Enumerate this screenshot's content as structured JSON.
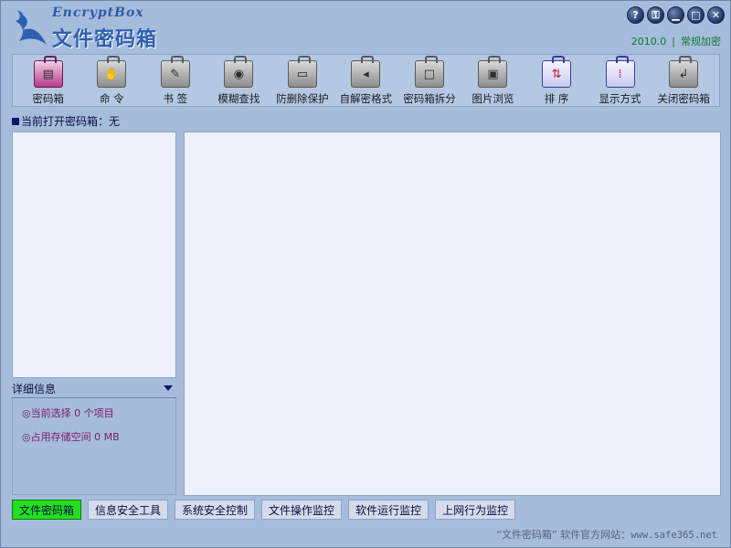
{
  "app": {
    "logo_script": "EncryptBox",
    "title": "文件密码箱",
    "version": "2010.0",
    "separator": "|",
    "edition": "常规加密"
  },
  "window_controls": [
    {
      "name": "help",
      "glyph": "?"
    },
    {
      "name": "key",
      "glyph": "⚿"
    },
    {
      "name": "minimize-to-tray",
      "glyph": "▁"
    },
    {
      "name": "maximize",
      "glyph": "□"
    },
    {
      "name": "close",
      "glyph": "✕"
    }
  ],
  "toolbar": {
    "items": [
      {
        "label": "密码箱",
        "icon": "password-box-icon",
        "glyph": "▤"
      },
      {
        "label": "命  令",
        "icon": "command-icon",
        "glyph": "✋"
      },
      {
        "label": "书  签",
        "icon": "bookmark-icon",
        "glyph": "✎"
      },
      {
        "label": "模糊查找",
        "icon": "search-icon",
        "glyph": "◉"
      },
      {
        "label": "防删除保护",
        "icon": "delete-protect-icon",
        "glyph": "▭"
      },
      {
        "label": "自解密格式",
        "icon": "self-decrypt-icon",
        "glyph": "◂"
      },
      {
        "label": "密码箱拆分",
        "icon": "split-icon",
        "glyph": "□"
      },
      {
        "label": "图片浏览",
        "icon": "image-browse-icon",
        "glyph": "▣"
      },
      {
        "label": "排  序",
        "icon": "sort-icon",
        "glyph": "⇅"
      },
      {
        "label": "显示方式",
        "icon": "view-mode-icon",
        "glyph": "⁞"
      },
      {
        "label": "关闭密码箱",
        "icon": "close-box-icon",
        "glyph": "↲"
      }
    ]
  },
  "current_box": {
    "label": "当前打开密码箱：无"
  },
  "details": {
    "header": "详细信息",
    "selected": "◎当前选择 0 个项目",
    "storage": "◎占用存储空间 0 MB"
  },
  "tabs": [
    {
      "label": "文件密码箱",
      "active": true
    },
    {
      "label": "信息安全工具",
      "active": false
    },
    {
      "label": "系统安全控制",
      "active": false
    },
    {
      "label": "文件操作监控",
      "active": false
    },
    {
      "label": "软件运行监控",
      "active": false
    },
    {
      "label": "上网行为监控",
      "active": false
    }
  ],
  "footer": {
    "text": "“文件密码箱” 软件官方网站：",
    "url": "www.safe365.net"
  },
  "colors": {
    "background": "#a6bcdb",
    "active_tab": "#22e020",
    "edition_text": "#0f7a2e",
    "title_blue": "#2e5fb0"
  }
}
